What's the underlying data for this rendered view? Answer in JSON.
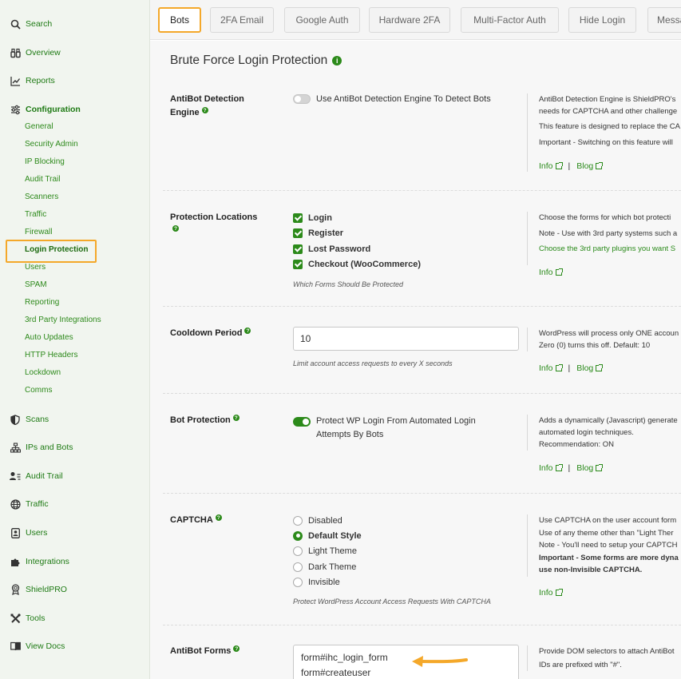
{
  "sidebar": {
    "main_items": [
      {
        "label": "Search",
        "icon": "search-icon"
      },
      {
        "label": "Overview",
        "icon": "binoculars-icon"
      },
      {
        "label": "Reports",
        "icon": "chart-line-icon"
      },
      {
        "label": "Configuration",
        "icon": "sliders-icon"
      },
      {
        "label": "Scans",
        "icon": "shield-icon"
      },
      {
        "label": "IPs and Bots",
        "icon": "diagram-icon"
      },
      {
        "label": "Audit Trail",
        "icon": "person-lines-icon"
      },
      {
        "label": "Traffic",
        "icon": "globe-icon"
      },
      {
        "label": "Users",
        "icon": "person-badge-icon"
      },
      {
        "label": "Integrations",
        "icon": "puzzle-icon"
      },
      {
        "label": "ShieldPRO",
        "icon": "award-icon"
      },
      {
        "label": "Tools",
        "icon": "tools-icon"
      },
      {
        "label": "View Docs",
        "icon": "book-icon"
      }
    ],
    "config_items": [
      "General",
      "Security Admin",
      "IP Blocking",
      "Audit Trail",
      "Scanners",
      "Traffic",
      "Firewall",
      "Login Protection",
      "Users",
      "SPAM",
      "Reporting",
      "3rd Party Integrations",
      "Auto Updates",
      "HTTP Headers",
      "Lockdown",
      "Comms"
    ]
  },
  "tabs": [
    "Bots",
    "2FA Email",
    "Google Auth",
    "Hardware 2FA",
    "Multi-Factor Auth",
    "Hide Login",
    "Messa"
  ],
  "page": {
    "title": "Brute Force Login Protection"
  },
  "common": {
    "info": "Info",
    "blog": "Blog",
    "sep": "|",
    "q": "?",
    "i": "i"
  },
  "antibot": {
    "label": "AntiBot Detection Engine",
    "toggle_label": "Use AntiBot Detection Engine To Detect Bots",
    "desc": [
      "AntiBot Detection Engine is ShieldPRO's",
      "needs for CAPTCHA and other challenge",
      "This feature is designed to replace the CA",
      "Important - Switching on this feature will"
    ]
  },
  "locations": {
    "label": "Protection Locations",
    "options": [
      "Login",
      "Register",
      "Lost Password",
      "Checkout (WooCommerce)"
    ],
    "help": "Which Forms Should Be Protected",
    "desc": [
      "Choose the forms for which bot protecti",
      "Note - Use with 3rd party systems such a"
    ],
    "desc_link": "Choose the 3rd party plugins you want S"
  },
  "cooldown": {
    "label": "Cooldown Period",
    "value": "10",
    "help": "Limit account access requests to every X seconds",
    "desc": [
      "WordPress will process only ONE accoun",
      "Zero (0) turns this off. Default: 10"
    ]
  },
  "botprotection": {
    "label": "Bot Protection",
    "toggle_label_1": "Protect WP Login From Automated Login",
    "toggle_label_2": "Attempts By Bots",
    "desc": [
      "Adds a dynamically (Javascript) generate",
      "automated login techniques.",
      "Recommendation: ON"
    ]
  },
  "captcha": {
    "label": "CAPTCHA",
    "options": [
      "Disabled",
      "Default Style",
      "Light Theme",
      "Dark Theme",
      "Invisible"
    ],
    "selected": "Default Style",
    "help": "Protect WordPress Account Access Requests With CAPTCHA",
    "desc": [
      "Use CAPTCHA on the user account form",
      "Use of any theme other than \"Light Ther",
      "Note - You'll need to setup your CAPTCH"
    ],
    "desc_bold": [
      "Important - Some forms are more dyna",
      "use non-Invisible CAPTCHA."
    ]
  },
  "antibotforms": {
    "label": "AntiBot Forms",
    "value_lines": [
      "form#ihc_login_form",
      "form#createuser"
    ],
    "desc": [
      "Provide DOM selectors to attach AntiBot",
      "IDs are prefixed with \"#\"."
    ]
  },
  "colors": {
    "accent": "#2c8a1a",
    "highlight": "#f4a82a"
  }
}
